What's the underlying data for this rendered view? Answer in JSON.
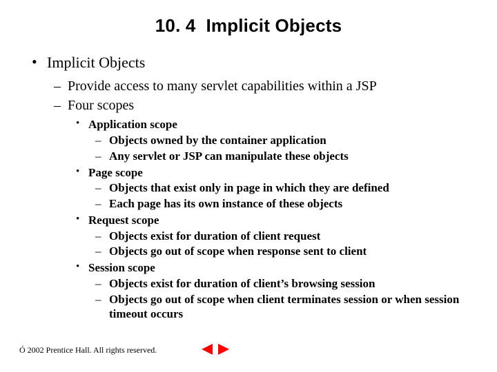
{
  "title": {
    "number": "10. 4",
    "text": "Implicit Objects"
  },
  "content": {
    "l1": "Implicit Objects",
    "l2": [
      "Provide access to many servlet capabilities within a JSP",
      "Four scopes"
    ],
    "scopes": [
      {
        "name": "Application scope",
        "items": [
          "Objects owned by the container application",
          "Any servlet or JSP can manipulate these objects"
        ]
      },
      {
        "name": "Page scope",
        "items": [
          "Objects that exist only in page in which they are defined",
          "Each page has its own instance of these objects"
        ]
      },
      {
        "name": "Request scope",
        "items": [
          "Objects exist for duration of client request",
          "Objects go out of scope when response sent to client"
        ]
      },
      {
        "name": "Session scope",
        "items": [
          "Objects exist for duration of client’s browsing session",
          "Objects go out of scope when client terminates session or when session timeout occurs"
        ]
      }
    ]
  },
  "footer": {
    "symbol": "Ó",
    "text": "2002 Prentice Hall. All rights reserved."
  }
}
